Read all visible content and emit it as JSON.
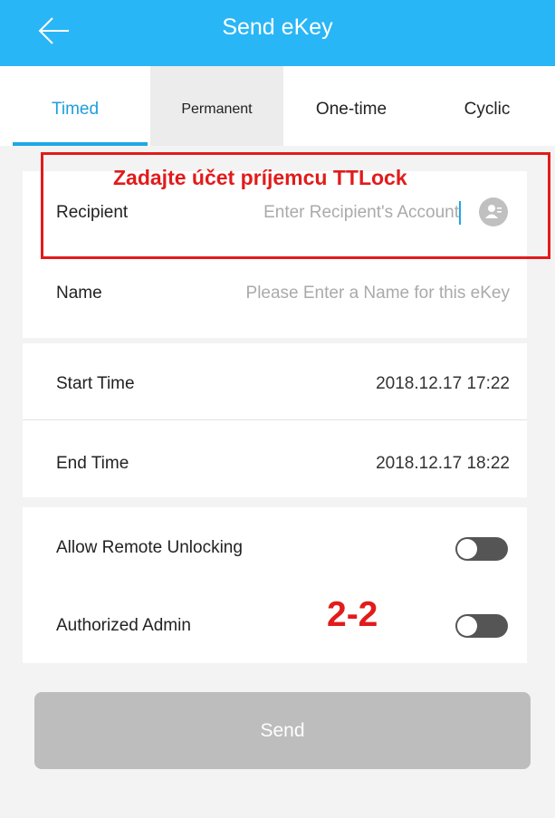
{
  "header": {
    "title": "Send eKey",
    "back_icon": "arrow-left-icon"
  },
  "tabs": [
    {
      "label": "Timed",
      "active": true
    },
    {
      "label": "Permanent",
      "active": false
    },
    {
      "label": "One-time",
      "active": false
    },
    {
      "label": "Cyclic",
      "active": false
    }
  ],
  "form": {
    "recipient": {
      "label": "Recipient",
      "placeholder": "Enter Recipient's Account",
      "icon": "contact-icon"
    },
    "name": {
      "label": "Name",
      "placeholder": "Please Enter a Name for this eKey"
    }
  },
  "time": {
    "start": {
      "label": "Start Time",
      "value": "2018.12.17 17:22"
    },
    "end": {
      "label": "End Time",
      "value": "2018.12.17 18:22"
    }
  },
  "options": {
    "remote": {
      "label": "Allow Remote Unlocking",
      "on": false
    },
    "admin": {
      "label": "Authorized Admin",
      "on": false
    }
  },
  "send_label": "Send",
  "annotation": {
    "text": "Zadajte účet príjemcu TTLock",
    "number": "2-2",
    "color": "#e21b1b"
  },
  "colors": {
    "header": "#29b6f6",
    "accent": "#1e9ede",
    "send_disabled": "#bdbdbd"
  }
}
